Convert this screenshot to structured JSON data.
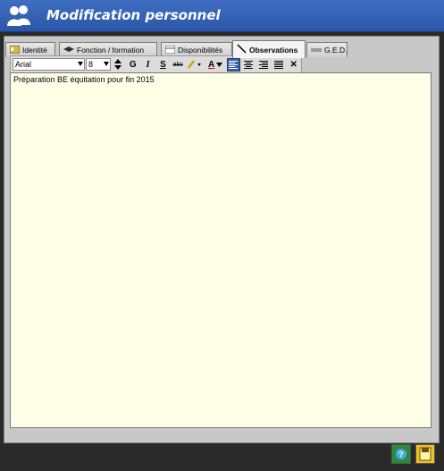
{
  "window": {
    "title": "Modification personnel",
    "title_icon": "users-icon"
  },
  "tabs": [
    {
      "label": "Identité",
      "icon": "id-card-icon",
      "active": false
    },
    {
      "label": "Fonction / formation",
      "icon": "graduation-cap-icon",
      "active": false
    },
    {
      "label": "Disponibilités",
      "icon": "calendar-icon",
      "active": false
    },
    {
      "label": "Observations",
      "icon": "pen-icon",
      "active": true
    },
    {
      "label": "G.E.D.",
      "icon": "document-icon",
      "active": false
    }
  ],
  "toolbar": {
    "font_family": "Arial",
    "font_size": "8",
    "bold_label": "G",
    "italic_label": "I",
    "strike_label": "S",
    "abc_label": "abc",
    "color_label": "A",
    "clear_label": "✕",
    "align_selected": "left"
  },
  "editor": {
    "content": "Préparation BE équitation pour fin 2015"
  },
  "colors": {
    "titlebar": "#3a67ba",
    "editor_bg": "#ffffe8",
    "help_button": "#2d8a3a",
    "save_button": "#f0c020"
  }
}
